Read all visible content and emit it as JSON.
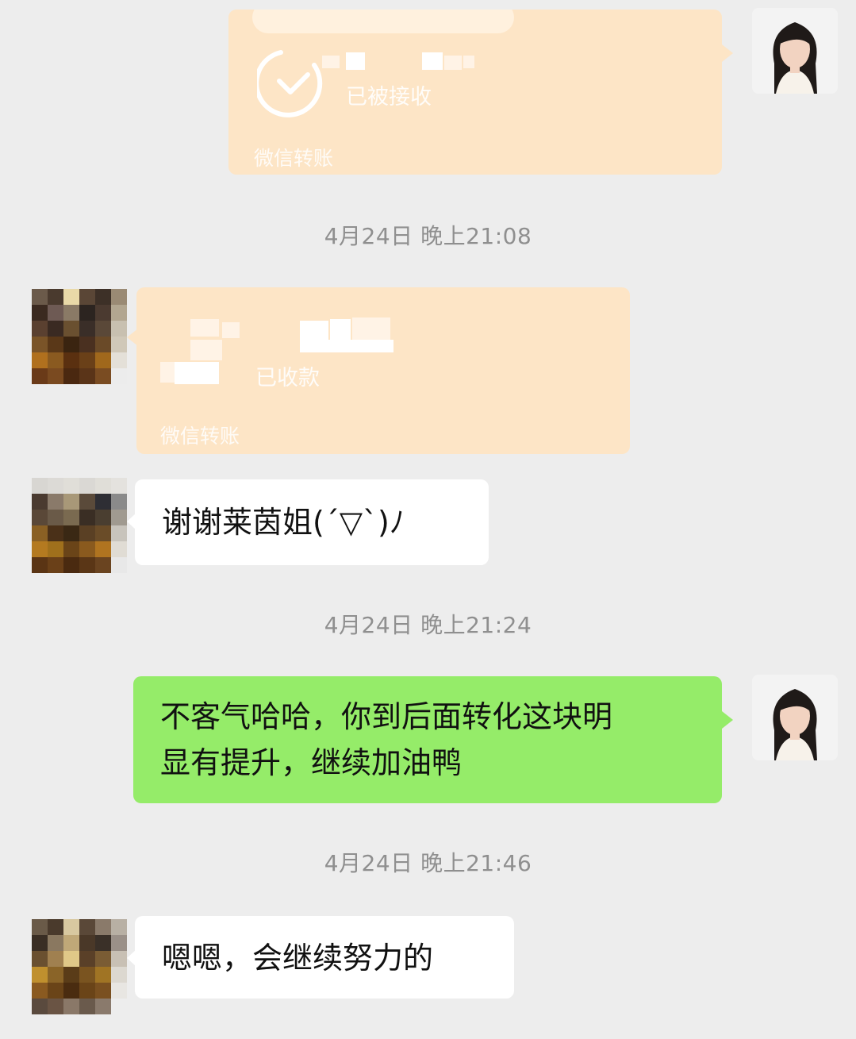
{
  "colors": {
    "background": "#ededed",
    "timestamp_text": "#8f8f8f",
    "transfer_card": "#fde5c6",
    "incoming_bubble": "#ffffff",
    "outgoing_bubble": "#95ec69"
  },
  "transfer_cards": [
    {
      "sender": "self",
      "status_text": "已被接收",
      "footer_label": "微信转账",
      "icon": "clock-check-icon"
    },
    {
      "sender": "contact",
      "status_text": "已收款",
      "footer_label": "微信转账",
      "icon": ""
    }
  ],
  "timestamps": [
    "4月24日 晚上21:08",
    "4月24日 晚上21:24",
    "4月24日 晚上21:46"
  ],
  "messages": [
    {
      "sender": "contact",
      "text": "谢谢莱茵姐(´▽`)ﾉ"
    },
    {
      "sender": "self",
      "line1": "不客气哈哈，你到后面转化这块明",
      "line2": "显有提升，继续加油鸭"
    },
    {
      "sender": "contact",
      "text": "嗯嗯，会继续努力的"
    }
  ]
}
